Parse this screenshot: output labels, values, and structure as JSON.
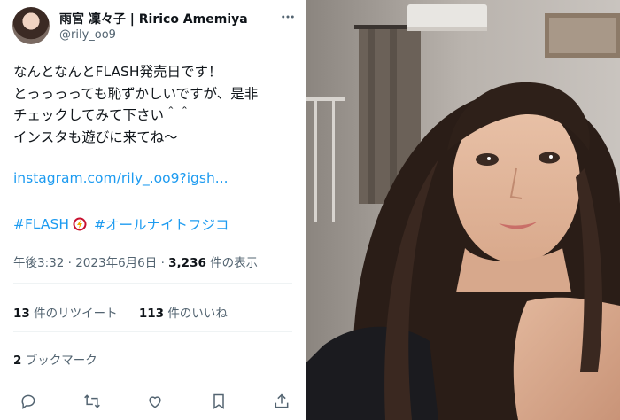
{
  "tweet": {
    "display_name": "雨宮 凜々子 | Ririco Amemiya",
    "handle": "@rily_oo9",
    "body": "なんとなんとFLASH発売日です！\nとっっっっても恥ずかしいですが、是非\nチェックしてみて下さい＾＾\nインスタも遊びに来てね〜",
    "link": "instagram.com/rily_.oo9?igsh...",
    "hashtags": [
      "#FLASH",
      "#オールナイトフジコ"
    ],
    "time": "午後3:32",
    "separator": "·",
    "date": "2023年6月6日",
    "views_count": "3,236",
    "views_label": "件の表示",
    "retweets_count": "13",
    "retweets_label": "件のリツイート",
    "likes_count": "113",
    "likes_label": "件のいいね",
    "bookmarks_count": "2",
    "bookmarks_label": "ブックマーク"
  },
  "icons": {
    "more": "more-icon",
    "hashtag_emoji": "flash-bolt-icon",
    "actions": [
      "reply-icon",
      "retweet-icon",
      "like-icon",
      "bookmark-icon",
      "share-icon"
    ]
  },
  "colors": {
    "link": "#1d9bf0",
    "text": "#0f1419",
    "secondary": "#536471",
    "divider": "#eff3f4"
  }
}
